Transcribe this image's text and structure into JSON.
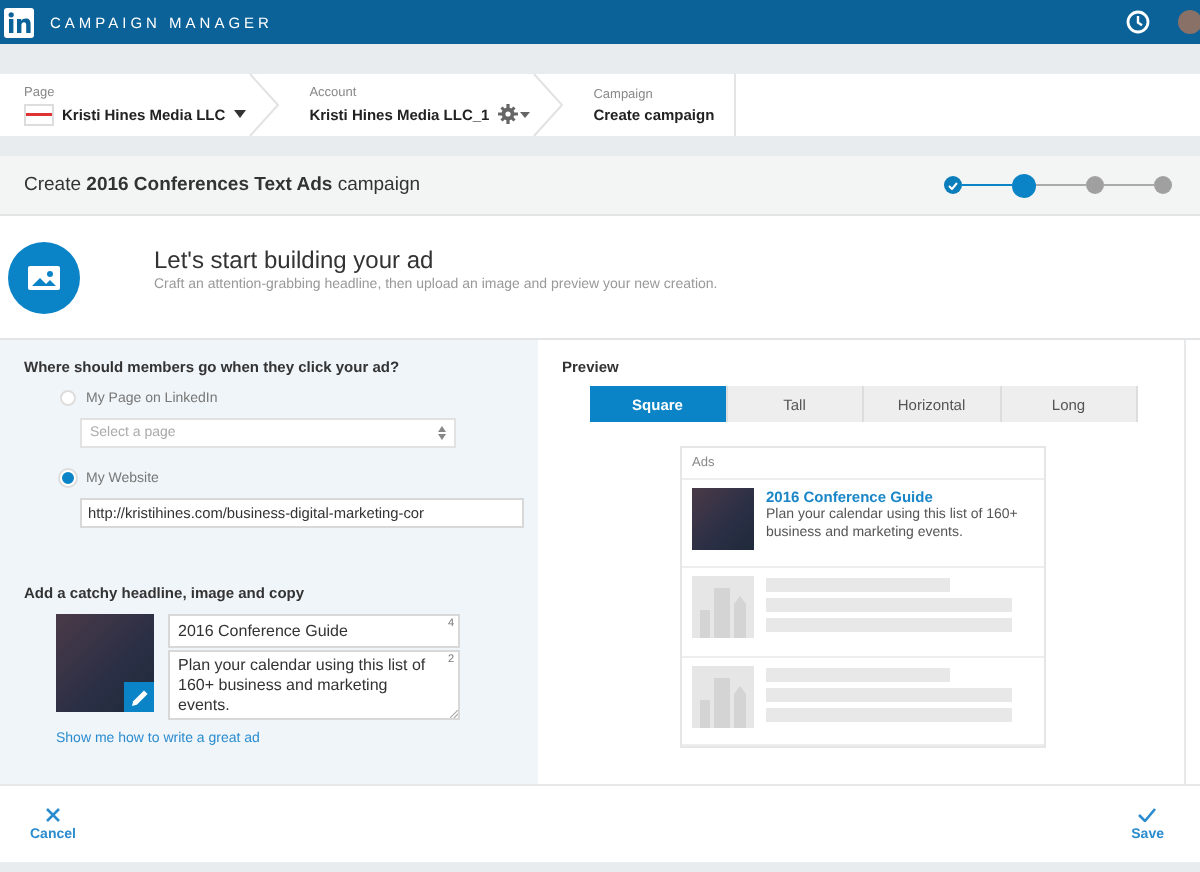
{
  "topbar": {
    "title": "CAMPAIGN MANAGER"
  },
  "breadcrumbs": [
    {
      "label": "Page",
      "value": "Kristi Hines Media LLC",
      "kind": "page"
    },
    {
      "label": "Account",
      "value": "Kristi Hines Media LLC_1",
      "kind": "account"
    },
    {
      "label": "Campaign",
      "value": "Create campaign",
      "kind": "plain"
    }
  ],
  "header": {
    "title": "Create **2016 Conferences Text Ads** campaign",
    "steps": [
      {
        "kind": "done"
      },
      {
        "kind": "current"
      },
      {
        "kind": "todo"
      },
      {
        "kind": "todo"
      }
    ]
  },
  "intro": {
    "title": "Let's start building your ad",
    "subtitle": "Craft an attention-grabbing headline, then upload an image and preview your new creation."
  },
  "destination": {
    "question": "Where should members go when they click your ad?",
    "options": [
      {
        "label": "My Page on LinkedIn",
        "selected": false,
        "kind": "select",
        "placeholder": "Select a page"
      },
      {
        "label": "My Website",
        "selected": true,
        "kind": "text",
        "value": "http://kristihines.com/business-digital-marketing-cor"
      }
    ]
  },
  "creative": {
    "title": "Add a catchy headline, image and copy",
    "headline": {
      "value": "2016 Conference Guide",
      "count": "4"
    },
    "description": {
      "value": "Plan your calendar using this list of 160+ business and marketing events.",
      "count": "2"
    },
    "help_link": "Show me how to write a great ad"
  },
  "preview": {
    "title": "Preview",
    "tabs": [
      {
        "label": "Square",
        "selected": true
      },
      {
        "label": "Tall",
        "selected": false
      },
      {
        "label": "Horizontal",
        "selected": false
      },
      {
        "label": "Long",
        "selected": false
      }
    ],
    "ads_label": "Ads",
    "ad": {
      "headline": "2016 Conference Guide",
      "text": "Plan your calendar using this list of 160+ business and marketing events."
    }
  },
  "footer": {
    "cancel": "Cancel",
    "save": "Save"
  }
}
